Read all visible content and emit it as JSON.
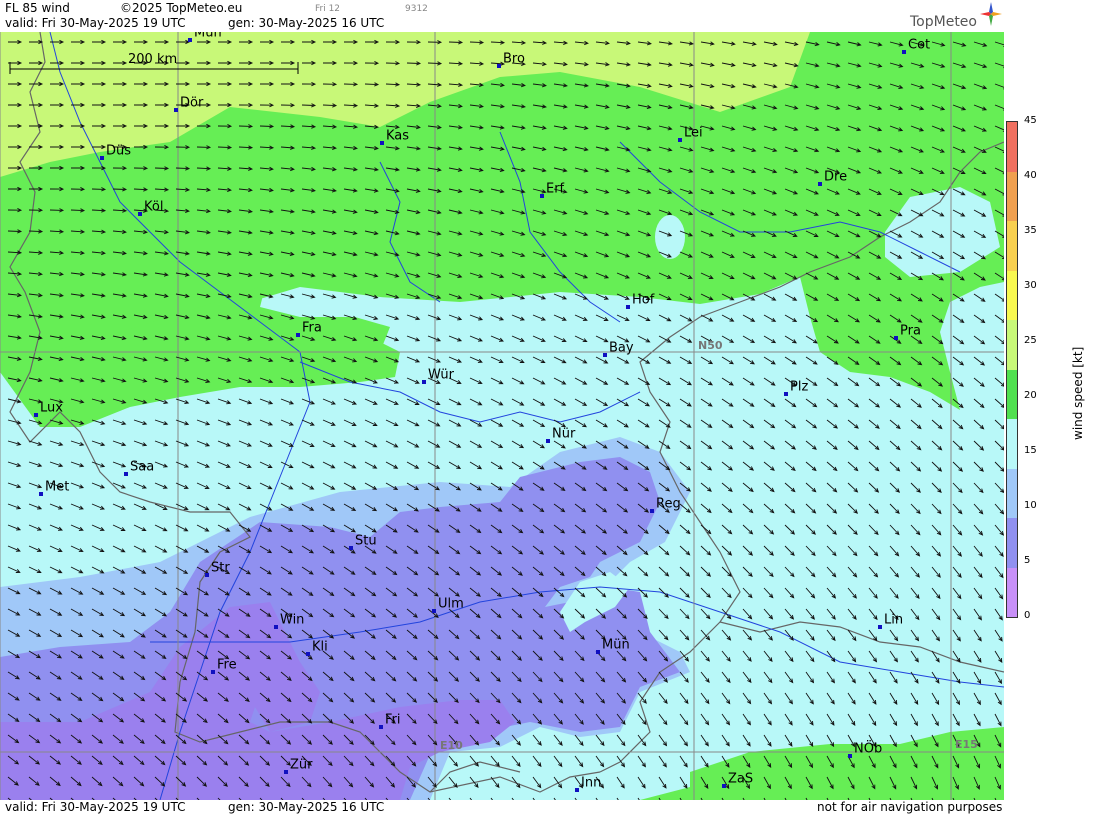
{
  "header": {
    "title": "FL 85 wind",
    "copyright": "©2025 TopMeteo.eu",
    "valid": "valid:  Fri  30-May-2025  19 UTC",
    "gen": "gen: 30-May-2025 16 UTC",
    "small_label_1": "Fri 12",
    "small_label_2": "9312",
    "logo": "TopMeteo"
  },
  "footer": {
    "valid": "valid:  Fri  30-May-2025  19 UTC",
    "gen": "gen: 30-May-2025 16 UTC",
    "disclaimer": "not for air navigation purposes"
  },
  "map": {
    "scale_label": "200 km",
    "grid_labels": {
      "n50": "N50",
      "e10": "E10",
      "e15": "E15"
    },
    "cities": [
      {
        "name": "Mün"
      },
      {
        "name": "Bro"
      },
      {
        "name": "Cot"
      },
      {
        "name": "Dör"
      },
      {
        "name": "Kas"
      },
      {
        "name": "Lei"
      },
      {
        "name": "Düs"
      },
      {
        "name": "Erf"
      },
      {
        "name": "Dre"
      },
      {
        "name": "Köl"
      },
      {
        "name": "Hof"
      },
      {
        "name": "Fra"
      },
      {
        "name": "Pra"
      },
      {
        "name": "Bay"
      },
      {
        "name": "Wür"
      },
      {
        "name": "Plz"
      },
      {
        "name": "Lux"
      },
      {
        "name": "Nür"
      },
      {
        "name": "Saa"
      },
      {
        "name": "Met"
      },
      {
        "name": "Reg"
      },
      {
        "name": "Stu"
      },
      {
        "name": "Str"
      },
      {
        "name": "Ulm"
      },
      {
        "name": "Win"
      },
      {
        "name": "Lin"
      },
      {
        "name": "Kli"
      },
      {
        "name": "Mün"
      },
      {
        "name": "Fre"
      },
      {
        "name": "Fri"
      },
      {
        "name": "NÖb"
      },
      {
        "name": "Zür"
      },
      {
        "name": "ZaS"
      },
      {
        "name": "Inn"
      }
    ]
  },
  "colorbar": {
    "title": "wind speed [kt]",
    "ticks": [
      "45",
      "40",
      "35",
      "30",
      "25",
      "20",
      "15",
      "10",
      "5",
      "0"
    ],
    "colors": [
      "#f07060",
      "#f0a050",
      "#f8d050",
      "#f8f850",
      "#c8f878",
      "#50e050",
      "#b8f8f8",
      "#a0c8f8",
      "#9090f0",
      "#c890f8"
    ]
  },
  "colors": {
    "green": "#66ee55",
    "light_green": "#c8f878",
    "cyan": "#b8f8f8",
    "light_blue": "#a0c8f8",
    "blue": "#9090f0",
    "violet": "#9a80ee",
    "city_marker": "#1010c0"
  }
}
